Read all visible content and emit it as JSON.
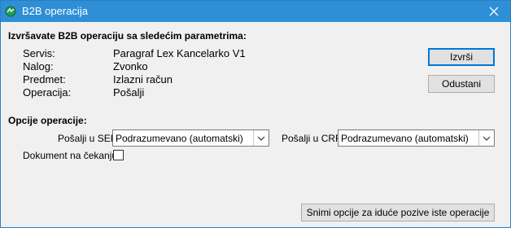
{
  "window": {
    "title": "B2B operacija"
  },
  "heading": "Izvršavate B2B operaciju sa sledećim parametrima:",
  "params": [
    {
      "label": "Servis:",
      "value": "Paragraf Lex Kancelarko V1"
    },
    {
      "label": "Nalog:",
      "value": "Zvonko"
    },
    {
      "label": "Predmet:",
      "value": "Izlazni račun"
    },
    {
      "label": "Operacija:",
      "value": "Pošalji"
    }
  ],
  "buttons": {
    "execute": "Izvrši",
    "cancel": "Odustani",
    "save_options": "Snimi opcije za iduće pozive iste operacije"
  },
  "options": {
    "title": "Opcije operacije:",
    "sef_label": "Pošalji u SEF:",
    "sef_value": "Podrazumevano (automatski)",
    "crf_label": "Pošalji u CRF:",
    "crf_value": "Podrazumevano (automatski)",
    "pending_label": "Dokument na čekanju:",
    "pending_checked": false
  },
  "colors": {
    "titlebar": "#2e8fd6",
    "accent": "#0078d7"
  }
}
